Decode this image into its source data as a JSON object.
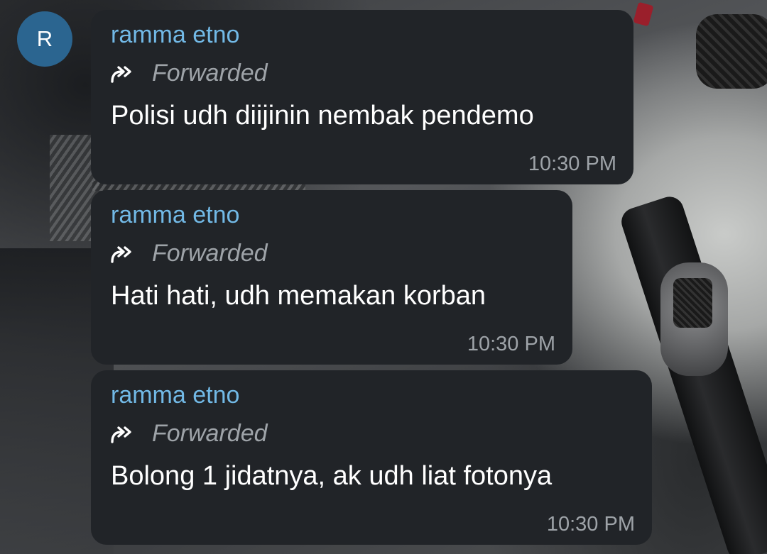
{
  "avatar": {
    "initial": "R",
    "color": "#2b6590"
  },
  "colors": {
    "bubble": "#212428",
    "sender": "#72b9e6",
    "meta": "#9ea3a8",
    "text": "#ffffff"
  },
  "messages": [
    {
      "sender": "ramma etno",
      "forwarded_label": "Forwarded",
      "text": "Polisi udh diijinin nembak pendemo",
      "time": "10:30 PM"
    },
    {
      "sender": "ramma etno",
      "forwarded_label": "Forwarded",
      "text": "Hati hati, udh memakan korban",
      "time": "10:30 PM"
    },
    {
      "sender": "ramma etno",
      "forwarded_label": "Forwarded",
      "text": "Bolong 1 jidatnya, ak udh liat fotonya",
      "time": "10:30 PM"
    }
  ],
  "icons": {
    "forward": "forward-double-arrow-icon"
  }
}
